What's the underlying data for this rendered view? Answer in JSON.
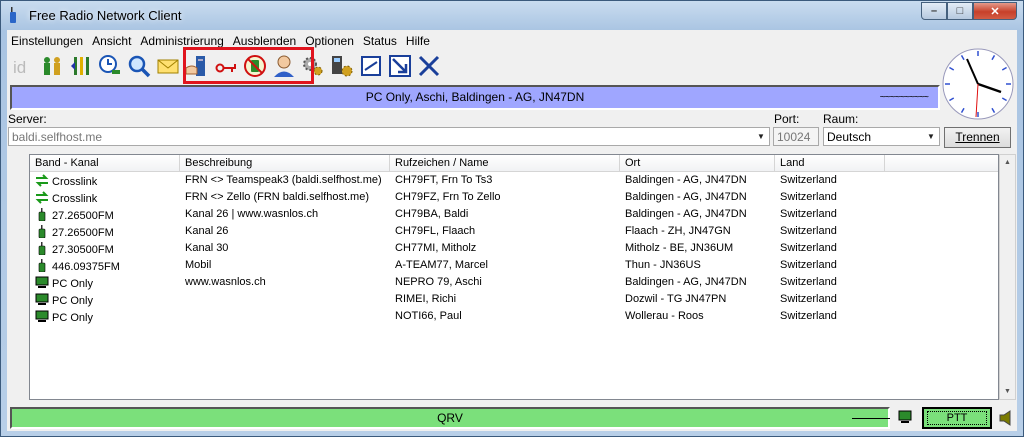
{
  "window": {
    "title": "Free Radio Network Client",
    "controls": {
      "minimize": "–",
      "maximize": "□",
      "close": "✕"
    }
  },
  "menu": [
    {
      "label": "Einstellungen"
    },
    {
      "label": "Ansicht"
    },
    {
      "label": "Administrierung"
    },
    {
      "label": "Ausblenden"
    },
    {
      "label": "Optionen"
    },
    {
      "label": "Status"
    },
    {
      "label": "Hilfe"
    }
  ],
  "toolbar_icons": [
    "id-icon",
    "people-icon",
    "tuning-icon",
    "clock-search-icon",
    "magnifier-icon",
    "mail-icon",
    "server-hand-icon",
    "key-icon",
    "phone-ban-icon",
    "user-avatar-icon",
    "gears-icon",
    "computer-gear-icon",
    "monitor-icon",
    "resize-icon",
    "close-x-icon"
  ],
  "status_top": {
    "text": "PC Only, Aschi, Baldingen - AG, JN47DN",
    "wave": "~~~~~~~~~~"
  },
  "connection": {
    "server_label": "Server:",
    "server_value": "baldi.selfhost.me",
    "port_label": "Port:",
    "port_value": "10024",
    "room_label": "Raum:",
    "room_value": "Deutsch",
    "disconnect_label": "Trennen"
  },
  "table": {
    "columns": [
      "Band - Kanal",
      "Beschreibung",
      "Rufzeichen / Name",
      "Ort",
      "Land"
    ],
    "rows": [
      {
        "icon": "crosslink",
        "band": "Crosslink",
        "desc": "FRN <> Teamspeak3 (baldi.selfhost.me)",
        "call": "CH79FT, Frn To Ts3",
        "ort": "Baldingen - AG, JN47DN",
        "land": "Switzerland"
      },
      {
        "icon": "crosslink",
        "band": "Crosslink",
        "desc": "FRN <> Zello (FRN baldi.selfhost.me)",
        "call": "CH79FZ, Frn To Zello",
        "ort": "Baldingen - AG, JN47DN",
        "land": "Switzerland"
      },
      {
        "icon": "radio",
        "band": "27.26500FM",
        "desc": "Kanal 26 | www.wasnlos.ch",
        "call": "CH79BA, Baldi",
        "ort": "Baldingen - AG, JN47DN",
        "land": "Switzerland"
      },
      {
        "icon": "radio",
        "band": "27.26500FM",
        "desc": "Kanal 26",
        "call": "CH79FL, Flaach",
        "ort": "Flaach - ZH, JN47GN",
        "land": "Switzerland"
      },
      {
        "icon": "radio",
        "band": "27.30500FM",
        "desc": "Kanal 30",
        "call": "CH77MI, Mitholz",
        "ort": "Mitholz - BE, JN36UM",
        "land": "Switzerland"
      },
      {
        "icon": "radio",
        "band": "446.09375FM",
        "desc": "Mobil",
        "call": "A-TEAM77, Marcel",
        "ort": "Thun - JN36US",
        "land": "Switzerland"
      },
      {
        "icon": "pc",
        "band": "PC Only",
        "desc": "www.wasnlos.ch",
        "call": "NEPRO 79, Aschi",
        "ort": "Baldingen - AG, JN47DN",
        "land": "Switzerland"
      },
      {
        "icon": "pc",
        "band": "PC Only",
        "desc": "",
        "call": "RIMEI, Richi",
        "ort": "Dozwil - TG JN47PN",
        "land": "Switzerland"
      },
      {
        "icon": "pc",
        "band": "PC Only",
        "desc": "",
        "call": "NOTI66, Paul",
        "ort": "Wollerau - Roos",
        "land": "Switzerland"
      }
    ]
  },
  "status_bottom": {
    "text": "QRV"
  },
  "ptt": {
    "label": "PTT"
  },
  "colors": {
    "status_top_bg": "#9fa6ff",
    "status_bottom_bg": "#7be07b",
    "highlight": "#e0141e"
  }
}
